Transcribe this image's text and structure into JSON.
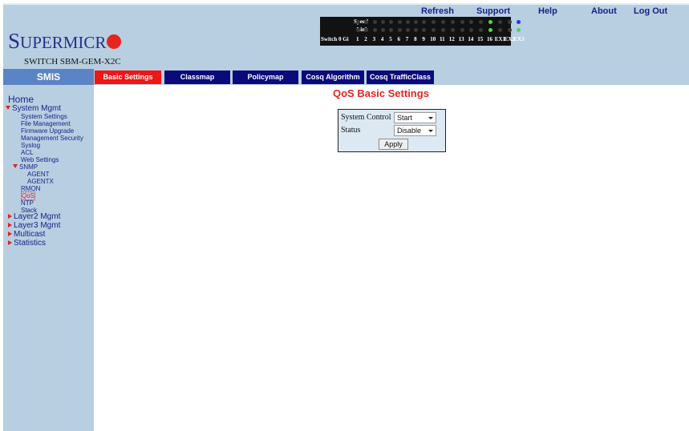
{
  "header": {
    "links": {
      "refresh": "Refresh",
      "support": "Support",
      "help": "Help",
      "about": "About",
      "logout": "Log Out"
    },
    "logo": {
      "text_main": "SUPERMICR",
      "text_s": "S",
      "text_uper": "UPERMICR"
    },
    "model": "SWITCH SBM-GEM-X2C",
    "led_panel": {
      "speed_label": "Speed",
      "link_label": "Link",
      "switch_label": "Switch 0 Gi",
      "ports": [
        "1",
        "2",
        "3",
        "4",
        "5",
        "6",
        "7",
        "8",
        "9",
        "10",
        "11",
        "12",
        "13",
        "14",
        "15",
        "16",
        "EX1",
        "EX2",
        "EX3"
      ],
      "speed_states": [
        "off",
        "off",
        "off",
        "off",
        "off",
        "off",
        "off",
        "off",
        "off",
        "off",
        "off",
        "off",
        "off",
        "off",
        "off",
        "green",
        "off",
        "off",
        "blue"
      ],
      "link_states": [
        "off",
        "off",
        "off",
        "off",
        "off",
        "off",
        "off",
        "off",
        "off",
        "off",
        "off",
        "off",
        "off",
        "off",
        "off",
        "green",
        "off",
        "off",
        "green"
      ],
      "colors": {
        "off": "#3a3a3a",
        "green": "#4fd84a",
        "blue": "#2232ff"
      }
    }
  },
  "smis": "SMIS",
  "tabs": [
    {
      "label": "Basic Settings",
      "active": true
    },
    {
      "label": "Classmap",
      "active": false
    },
    {
      "label": "Policymap",
      "active": false
    },
    {
      "label": "Cosq Algorithm",
      "active": false
    },
    {
      "label": "Cosq TrafficClass",
      "active": false
    }
  ],
  "sidebar": {
    "home": "Home",
    "system_mgmt": "System Mgmt",
    "system_items": [
      "System Settings",
      "File Management",
      "Firmware Upgrade",
      "Management Security",
      "Syslog",
      "ACL",
      "Web Settings"
    ],
    "snmp": "SNMP",
    "snmp_items": [
      "AGENT",
      "AGENTX"
    ],
    "post_items": [
      "RMON",
      "QoS",
      "NTP",
      "Stack"
    ],
    "selected": "QoS",
    "collapsed": [
      "Layer2 Mgmt",
      "Layer3 Mgmt",
      "Multicast",
      "Statistics"
    ]
  },
  "page": {
    "title": "QoS Basic Settings",
    "system_control_label": "System Control",
    "system_control_value": "Start",
    "status_label": "Status",
    "status_value": "Disable",
    "apply": "Apply"
  },
  "colors": {
    "accent_red": "#e8241f",
    "navy": "#0b0a7a",
    "panel_blue": "#b7cfe1",
    "smis_blue": "#5b84c4"
  }
}
